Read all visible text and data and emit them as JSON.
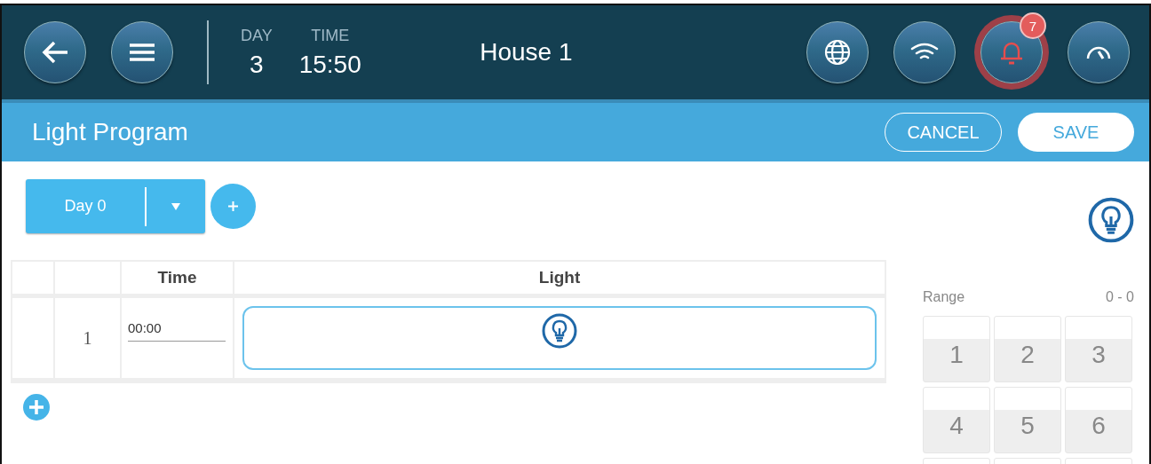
{
  "header": {
    "nav_buttons": [
      {
        "kind": "back"
      },
      {
        "kind": "menu"
      }
    ],
    "day": {
      "label": "DAY",
      "value": "3"
    },
    "time": {
      "label": "TIME",
      "value": "15:50"
    },
    "title": "House 1",
    "status_buttons": [
      {
        "kind": "globe"
      },
      {
        "kind": "wifi"
      },
      {
        "kind": "alarm",
        "badge": "7"
      },
      {
        "kind": "gauge"
      }
    ]
  },
  "toolbar": {
    "title": "Light Program",
    "buttons": [
      {
        "kind": "outline",
        "label": "CANCEL"
      },
      {
        "kind": "solid",
        "label": "SAVE"
      }
    ]
  },
  "day_selector": {
    "value": "Day 0"
  },
  "table": {
    "columns": [
      {
        "kind": "time",
        "label": "Time"
      },
      {
        "kind": "light",
        "label": "Light"
      }
    ],
    "rows": [
      {
        "number": "1",
        "time": "00:00"
      }
    ]
  },
  "keypad": {
    "range_label": "Range",
    "range": "0 - 0",
    "keys": [
      "1",
      "2",
      "3",
      "4",
      "5",
      "6"
    ]
  }
}
